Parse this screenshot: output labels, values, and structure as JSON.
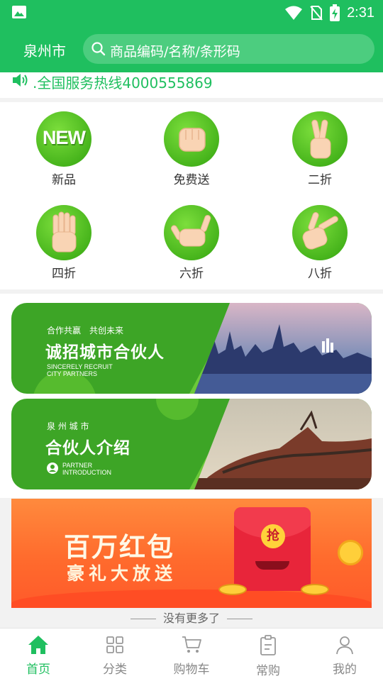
{
  "status_bar": {
    "time": "2:31"
  },
  "header": {
    "city": "泉州市",
    "search_placeholder": "商品编码/名称/条形码"
  },
  "notice": {
    "text": ".全国服务热线4000555869"
  },
  "categories": [
    {
      "label": "新品",
      "icon": "new-badge-icon",
      "badge": "NEW"
    },
    {
      "label": "免费送",
      "icon": "fist-hand-icon"
    },
    {
      "label": "二折",
      "icon": "two-fingers-hand-icon"
    },
    {
      "label": "四折",
      "icon": "four-fingers-hand-icon"
    },
    {
      "label": "六折",
      "icon": "six-hand-icon"
    },
    {
      "label": "八折",
      "icon": "eight-hand-icon"
    }
  ],
  "banners": [
    {
      "small": "合作共赢　共创未来",
      "big": "诚招城市合伙人",
      "eng1": "SINCERELY RECRUIT",
      "eng2": "CITY PARTNERS"
    },
    {
      "small": "泉 州 城 市",
      "big": "合伙人介绍",
      "eng1": "PARTNER",
      "eng2": "INTRODUCTION"
    }
  ],
  "promo": {
    "title": "百万红包",
    "subtitle": "豪礼大放送",
    "envelope_char": "抢"
  },
  "footer_note": "没有更多了",
  "tabs": [
    {
      "label": "首页",
      "icon": "home-icon",
      "active": true
    },
    {
      "label": "分类",
      "icon": "grid-icon",
      "active": false
    },
    {
      "label": "购物车",
      "icon": "cart-icon",
      "active": false
    },
    {
      "label": "常购",
      "icon": "clipboard-icon",
      "active": false
    },
    {
      "label": "我的",
      "icon": "user-icon",
      "active": false
    }
  ],
  "colors": {
    "brand_green": "#1fbf5f",
    "search_bg": "#4ccd7f",
    "promo_orange": "#ff6b2d"
  }
}
